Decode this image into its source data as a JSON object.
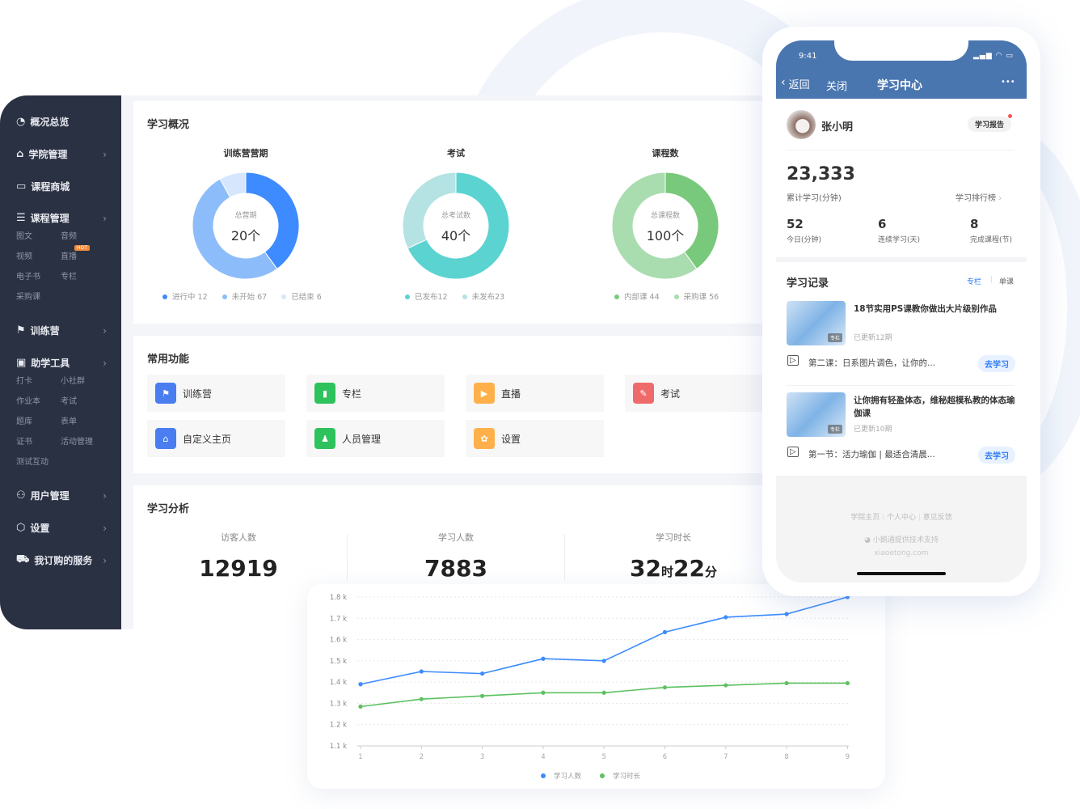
{
  "sidebar": {
    "items": [
      {
        "label": "概况总览",
        "icon": "pie-chart-icon"
      },
      {
        "label": "学院管理",
        "icon": "store-icon"
      },
      {
        "label": "课程商城",
        "icon": "book-icon"
      },
      {
        "label": "课程管理",
        "icon": "document-icon",
        "sub": [
          "图文",
          "音频",
          "视频",
          "直播",
          "电子书",
          "专栏",
          "采购课"
        ]
      },
      {
        "label": "训练营",
        "icon": "training-icon"
      },
      {
        "label": "助学工具",
        "icon": "toolbox-icon",
        "sub": [
          "打卡",
          "小社群",
          "作业本",
          "考试",
          "题库",
          "表单",
          "证书",
          "活动管理",
          "测试互动"
        ]
      },
      {
        "label": "用户管理",
        "icon": "user-icon"
      },
      {
        "label": "设置",
        "icon": "settings-icon"
      },
      {
        "label": "我订购的服务",
        "icon": "cart-icon"
      }
    ],
    "hot_badge": "HOT"
  },
  "overview": {
    "title": "学习概况",
    "donuts": [
      {
        "title": "训练营营期",
        "center_label": "总营期",
        "center_value": "20个",
        "legend": [
          "进行中 12",
          "未开始 67",
          "已结束 6"
        ],
        "shares": [
          0.4,
          0.52,
          0.08
        ],
        "colors": [
          "#3d8bff",
          "#8dbcfa",
          "#d6e7fd"
        ]
      },
      {
        "title": "考试",
        "center_label": "总考试数",
        "center_value": "40个",
        "legend": [
          "已发布12",
          "未发布23"
        ],
        "shares": [
          0.68,
          0.32
        ],
        "colors": [
          "#5bd3d1",
          "#b5e3e3"
        ]
      },
      {
        "title": "课程数",
        "center_label": "总课程数",
        "center_value": "100个",
        "legend": [
          "内部课 44",
          "采购课 56"
        ],
        "shares": [
          0.4,
          0.6
        ],
        "colors": [
          "#79c97c",
          "#a9dcaf"
        ]
      }
    ]
  },
  "functions": {
    "title": "常用功能",
    "items": [
      {
        "label": "训练营",
        "color": "#4a7ef0",
        "icon": "training-icon"
      },
      {
        "label": "专栏",
        "color": "#2ec25c",
        "icon": "bookmark-icon"
      },
      {
        "label": "直播",
        "color": "#ffb04a",
        "icon": "tv-icon"
      },
      {
        "label": "考试",
        "color": "#ef6b6b",
        "icon": "exam-icon"
      },
      {
        "label": "自定义主页",
        "color": "#4a7ef0",
        "icon": "store-icon"
      },
      {
        "label": "人员管理",
        "color": "#2ec25c",
        "icon": "person-icon"
      },
      {
        "label": "设置",
        "color": "#ffb04a",
        "icon": "gear-icon"
      }
    ]
  },
  "analysis": {
    "title": "学习分析",
    "stats": [
      {
        "label": "访客人数",
        "value": "12919"
      },
      {
        "label": "学习人数",
        "value": "7883"
      },
      {
        "label": "学习时长",
        "hours": "32",
        "hours_unit": "时",
        "minutes": "22",
        "minutes_unit": "分"
      }
    ]
  },
  "chart_data": {
    "type": "line",
    "x": [
      1,
      2,
      3,
      4,
      5,
      6,
      7,
      8,
      9
    ],
    "yticks": [
      "1.1 k",
      "1.2 k",
      "1.3 k",
      "1.4 k",
      "1.5 k",
      "1.6 k",
      "1.7 k",
      "1.8 k"
    ],
    "ylim": [
      1100,
      1800
    ],
    "grid": true,
    "legend_position": "bottom",
    "series": [
      {
        "name": "学习人数",
        "color": "#3d8bff",
        "values": [
          1390,
          1450,
          1440,
          1510,
          1500,
          1635,
          1705,
          1720,
          1800
        ]
      },
      {
        "name": "学习时长",
        "color": "#5cc160",
        "values": [
          1285,
          1320,
          1335,
          1350,
          1350,
          1375,
          1385,
          1395,
          1395
        ]
      }
    ]
  },
  "phone": {
    "time": "9:41",
    "back": "返回",
    "close": "关闭",
    "title": "学习中心",
    "more": "•••",
    "user": "张小明",
    "report": "学习报告",
    "total": "23,333",
    "total_label": "累计学习(分钟)",
    "ranking": "学习排行榜",
    "metrics": [
      {
        "value": "52",
        "label": "今日(分钟)"
      },
      {
        "value": "6",
        "label": "连续学习(天)"
      },
      {
        "value": "8",
        "label": "完成课程(节)"
      }
    ],
    "records_title": "学习记录",
    "tab_active": "专栏",
    "tab_other": "单课",
    "records": [
      {
        "title": "18节实用PS课教你做出大片级别作品",
        "tag": "专栏",
        "updated": "已更新12期",
        "lesson": "第二课：日系图片调色，让你的...",
        "action": "去学习"
      },
      {
        "title": "让你拥有轻盈体态，维秘超模私教的体态瑜伽课",
        "tag": "专栏",
        "updated": "已更新10期",
        "lesson": "第一节：活力瑜伽 | 最适合清晨...",
        "action": "去学习"
      }
    ],
    "footer_links": [
      "学院主页",
      "个人中心",
      "意见反馈"
    ],
    "powered": "小鹅通提供技术支持",
    "domain": "xiaoetong.com"
  }
}
